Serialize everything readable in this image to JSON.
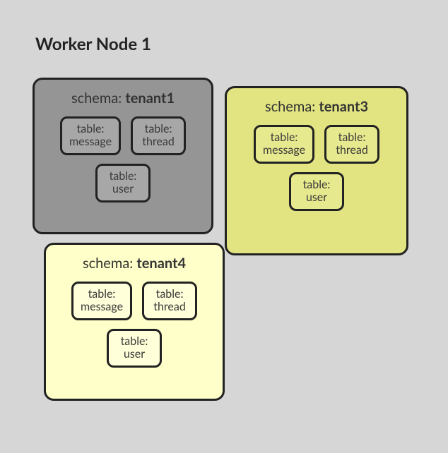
{
  "title": "Worker Node 1",
  "schemas": [
    {
      "key": "tenant1",
      "label_prefix": "schema: ",
      "name": "tenant1",
      "tables": [
        {
          "label": "table:",
          "name": "message"
        },
        {
          "label": "table:",
          "name": "thread"
        },
        {
          "label": "table:",
          "name": "user"
        }
      ]
    },
    {
      "key": "tenant3",
      "label_prefix": "schema: ",
      "name": "tenant3",
      "tables": [
        {
          "label": "table:",
          "name": "message"
        },
        {
          "label": "table:",
          "name": "thread"
        },
        {
          "label": "table:",
          "name": "user"
        }
      ]
    },
    {
      "key": "tenant4",
      "label_prefix": "schema: ",
      "name": "tenant4",
      "tables": [
        {
          "label": "table:",
          "name": "message"
        },
        {
          "label": "table:",
          "name": "thread"
        },
        {
          "label": "table:",
          "name": "user"
        }
      ]
    }
  ],
  "colors": {
    "page_bg": "#d6d6d6",
    "border": "#222222",
    "tenant1_bg": "#959595",
    "tenant3_bg": "#e2e482",
    "tenant4_bg": "#feffc9"
  }
}
